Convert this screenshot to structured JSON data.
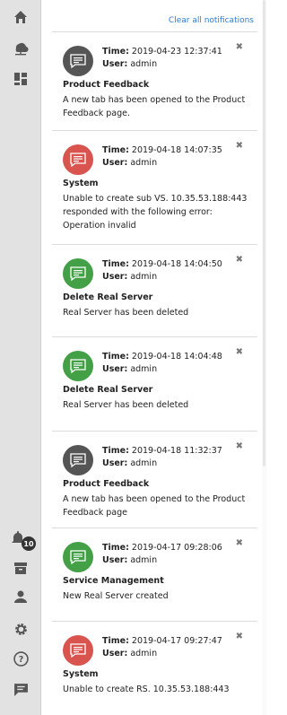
{
  "sidebar": {
    "items": [
      {
        "name": "home-icon"
      },
      {
        "name": "cloud-network-icon"
      },
      {
        "name": "dashboard-icon"
      },
      {
        "name": "bell-icon",
        "badge": "10"
      },
      {
        "name": "archive-icon"
      },
      {
        "name": "user-icon"
      },
      {
        "name": "gear-icon"
      },
      {
        "name": "help-icon"
      },
      {
        "name": "chat-icon"
      }
    ]
  },
  "panel": {
    "clear_all": "Clear all notifications"
  },
  "labels": {
    "time": "Time:",
    "user": "User:"
  },
  "notifications": [
    {
      "color": "#555555",
      "time": "2019-04-23 12:37:41",
      "user": "admin",
      "category": "Product Feedback",
      "message": "A new tab has been opened to the Product Feedback page."
    },
    {
      "color": "#d9534f",
      "time": "2019-04-18 14:07:35",
      "user": "admin",
      "category": "System",
      "message": "Unable to create sub VS. 10.35.53.188:443 responded with the following error: Operation invalid"
    },
    {
      "color": "#43a047",
      "time": "2019-04-18 14:04:50",
      "user": "admin",
      "category": "Delete Real Server",
      "message": "Real Server has been deleted"
    },
    {
      "color": "#43a047",
      "time": "2019-04-18 14:04:48",
      "user": "admin",
      "category": "Delete Real Server",
      "message": "Real Server has been deleted"
    },
    {
      "color": "#555555",
      "time": "2019-04-18 11:32:37",
      "user": "admin",
      "category": "Product Feedback",
      "message": "A new tab has been opened to the Product Feedback page"
    },
    {
      "color": "#43a047",
      "time": "2019-04-17 09:28:06",
      "user": "admin",
      "category": "Service Management",
      "message": "New Real Server created"
    },
    {
      "color": "#d9534f",
      "time": "2019-04-17 09:27:47",
      "user": "admin",
      "category": "System",
      "message": "Unable to create RS. 10.35.53.188:443"
    }
  ]
}
